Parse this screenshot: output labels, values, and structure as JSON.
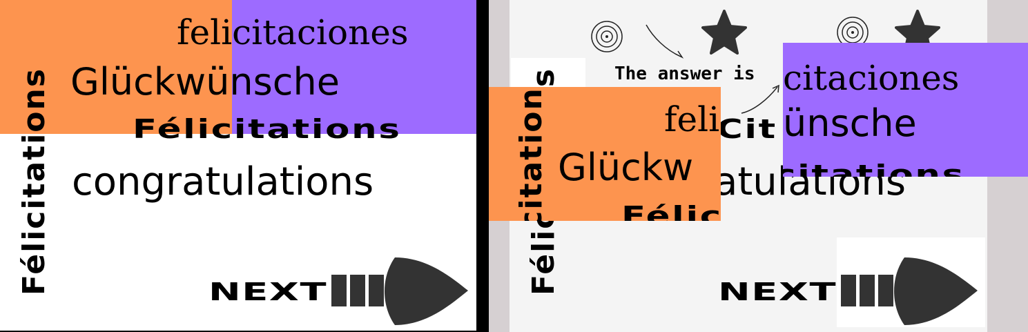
{
  "colors": {
    "orange": "#fd944f",
    "purple": "#9d6bff",
    "ink": "#000000",
    "dark_icon": "#333333",
    "right_canvas": "#f4f4f4",
    "right_frame": "#d6d0d2"
  },
  "left_card": {
    "vertical_word": "Félicitations",
    "spanish_word": "felicitaciones",
    "german_word": "Glückwünsche",
    "french_word": "Félicitations",
    "english_word": "congratulations",
    "next_label": "NEXT"
  },
  "right_card": {
    "vertical_word": "Félicitations",
    "spanish_front": "feli",
    "spanish_back": "citaciones",
    "german_front": "Glückw",
    "german_back": "ünsche",
    "french_front": "Félic",
    "french_mid": "Cit",
    "french_back": "citations",
    "english_tail": "atulations",
    "answer_text": "The answer is",
    "next_label": "NEXT",
    "icons": [
      "spiral-icon",
      "star-icon",
      "spiral-icon",
      "star-icon",
      "curved-arrow-icon",
      "curved-arrow-icon"
    ]
  }
}
